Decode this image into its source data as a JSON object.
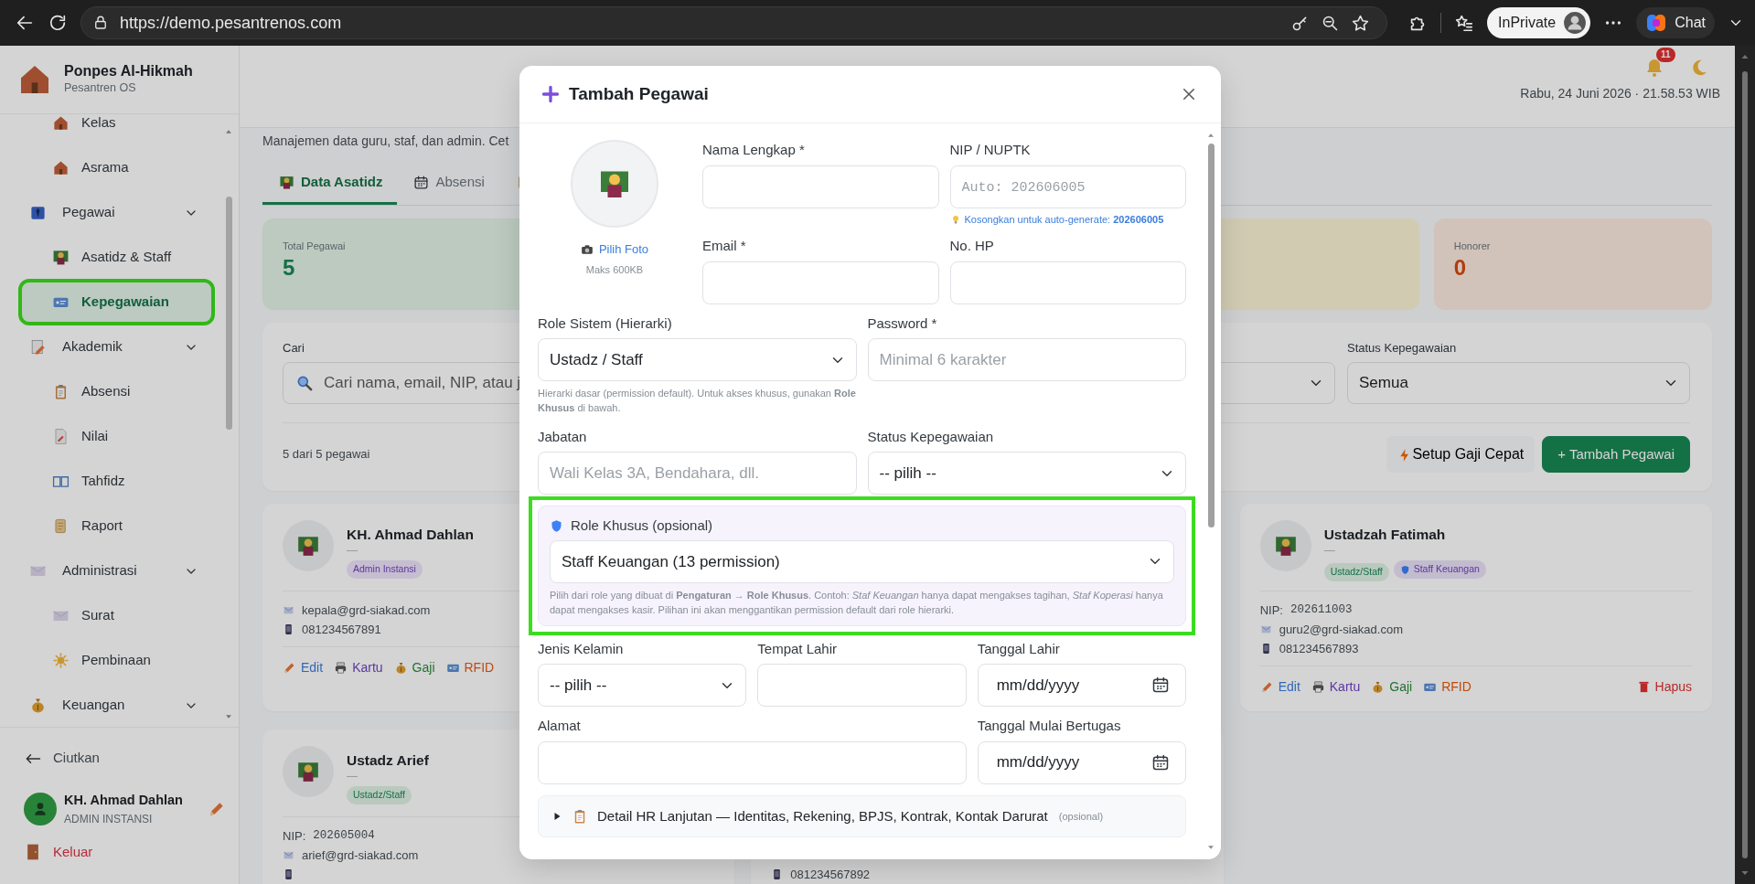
{
  "browser": {
    "url": "https://demo.pesantrenos.com",
    "profile_label": "InPrivate",
    "chat_label": "Chat"
  },
  "sidebar": {
    "brand": {
      "name": "Ponpes Al-Hikmah",
      "subtitle": "Pesantren OS"
    },
    "items": [
      {
        "kind": "continued",
        "children": [
          {
            "label": "Kelas",
            "selected": false,
            "highlighted": false
          },
          {
            "label": "Asrama",
            "selected": false,
            "highlighted": false
          }
        ]
      },
      {
        "kind": "group",
        "label": "Pegawai",
        "children": [
          {
            "label": "Asatidz & Staff",
            "selected": false,
            "highlighted": false
          },
          {
            "label": "Kepegawaian",
            "selected": true,
            "highlighted": true
          }
        ]
      },
      {
        "kind": "group",
        "label": "Akademik",
        "children": [
          {
            "label": "Absensi",
            "selected": false,
            "highlighted": false
          },
          {
            "label": "Nilai",
            "selected": false,
            "highlighted": false
          },
          {
            "label": "Tahfidz",
            "selected": false,
            "highlighted": false
          },
          {
            "label": "Raport",
            "selected": false,
            "highlighted": false
          }
        ]
      },
      {
        "kind": "group",
        "label": "Administrasi",
        "children": [
          {
            "label": "Surat",
            "selected": false,
            "highlighted": false
          },
          {
            "label": "Pembinaan",
            "selected": false,
            "highlighted": false
          }
        ]
      },
      {
        "kind": "group",
        "label": "Keuangan"
      }
    ],
    "collapse_label": "Ciutkan",
    "user": {
      "name": "KH. Ahmad Dahlan",
      "role": "ADMIN INSTANSI"
    },
    "logout_label": "Keluar"
  },
  "header": {
    "notification_count": "11",
    "date_time": "Rabu, 24 Juni 2026 · 21.58.53 WIB"
  },
  "page": {
    "description": "Manajemen data guru, staf, dan admin. Cet",
    "tabs": [
      {
        "label": "Data Asatidz",
        "selected": true
      },
      {
        "label": "Absensi",
        "selected": false
      },
      {
        "selected": false
      }
    ],
    "stats": [
      {
        "label": "Total Pegawai",
        "value": "5",
        "kind": "success"
      },
      {
        "kind": "warning"
      },
      {
        "label": "Honorer",
        "value": "0",
        "kind": "caution"
      }
    ],
    "filters": {
      "search": {
        "label": "Cari",
        "placeholder": "Cari nama, email, NIP, atau j"
      },
      "status": {
        "label": "Status Kepegawaian",
        "value": "Semua"
      },
      "count": "5 dari 5 pegawai",
      "buttons": [
        {
          "label": "Setup Gaji Cepat",
          "kind": "secondary"
        },
        {
          "label": "+ Tambah Pegawai",
          "kind": "primary"
        }
      ]
    },
    "employees": [
      {
        "kind": "full",
        "name": "KH. Ahmad Dahlan",
        "subtitle": "—",
        "badges": [
          {
            "label": "Admin Instansi",
            "kind": "admin"
          }
        ],
        "email": "kepala@grd-siakad.com",
        "phone": "081234567891",
        "actions": [
          {
            "label": "Edit",
            "kind": "edit"
          },
          {
            "label": "Kartu",
            "kind": "print"
          },
          {
            "label": "Gaji",
            "kind": "salary"
          },
          {
            "label": "RFID",
            "kind": "rfid"
          }
        ]
      },
      {
        "kind": "full",
        "name": "Ustadzah Fatimah",
        "subtitle": "—",
        "badges": [
          {
            "label": "Ustadz/Staff",
            "kind": "staff"
          },
          {
            "label": "Staff Keuangan",
            "kind": "custom_role"
          }
        ],
        "nip_label": "NIP:",
        "nip": "202611003",
        "email": "guru2@grd-siakad.com",
        "phone": "081234567893",
        "actions": [
          {
            "label": "Edit",
            "kind": "edit"
          },
          {
            "label": "Kartu",
            "kind": "print"
          },
          {
            "label": "Gaji",
            "kind": "salary"
          },
          {
            "label": "RFID",
            "kind": "rfid"
          },
          {
            "label": "Hapus",
            "kind": "delete"
          }
        ]
      },
      {
        "kind": "full",
        "name": "Ustadz Arief",
        "subtitle": "—",
        "badges": [
          {
            "label": "Ustadz/Staff",
            "kind": "staff"
          }
        ],
        "nip_label": "NIP:",
        "nip": "202605004",
        "email": "arief@grd-siakad.com"
      },
      {
        "kind": "partial",
        "phone": "081234567892"
      }
    ]
  },
  "dialog": {
    "title": "Tambah Pegawai",
    "photo": {
      "button_label": "Pilih Foto",
      "hint": "Maks 600KB"
    },
    "full_name": {
      "label": "Nama Lengkap *"
    },
    "nip": {
      "label": "NIP / NUPTK",
      "placeholder": "Auto: 202606005",
      "hint": "Kosongkan untuk auto-generate: **202606005**"
    },
    "email": {
      "label": "Email *"
    },
    "phone": {
      "label": "No. HP"
    },
    "system_role": {
      "label": "Role Sistem (Hierarki)",
      "value": "Ustadz / Staff",
      "help": "Hierarki dasar (permission default). Untuk akses khusus, gunakan **Role Khusus** di bawah."
    },
    "password": {
      "label": "Password *",
      "placeholder": "Minimal 6 karakter"
    },
    "position": {
      "label": "Jabatan",
      "placeholder": "Wali Kelas 3A, Bendahara, dll."
    },
    "employment_status": {
      "label": "Status Kepegawaian",
      "value": "-- pilih --"
    },
    "custom_role": {
      "label": "Role Khusus (opsional)",
      "value": "Staff Keuangan (13 permission)",
      "help": "Pilih dari role yang dibuat di **Pengaturan → Role Khusus**. Contoh: *Staf Keuangan* hanya dapat mengakses tagihan, *Staf Koperasi* hanya dapat mengakses kasir. Pilihan ini akan menggantikan permission default dari role hierarki.",
      "highlighted": true
    },
    "gender": {
      "label": "Jenis Kelamin",
      "value": "-- pilih --"
    },
    "birthplace": {
      "label": "Tempat Lahir"
    },
    "birthdate": {
      "label": "Tanggal Lahir",
      "placeholder": "mm/dd/yyyy"
    },
    "address": {
      "label": "Alamat"
    },
    "start_date": {
      "label": "Tanggal Mulai Bertugas",
      "placeholder": "mm/dd/yyyy"
    },
    "details": {
      "label": "Detail HR Lanjutan — Identitas, Rekening, BPJS, Kontrak, Kontak Darurat",
      "note": "(opsional)",
      "expanded": false
    }
  }
}
